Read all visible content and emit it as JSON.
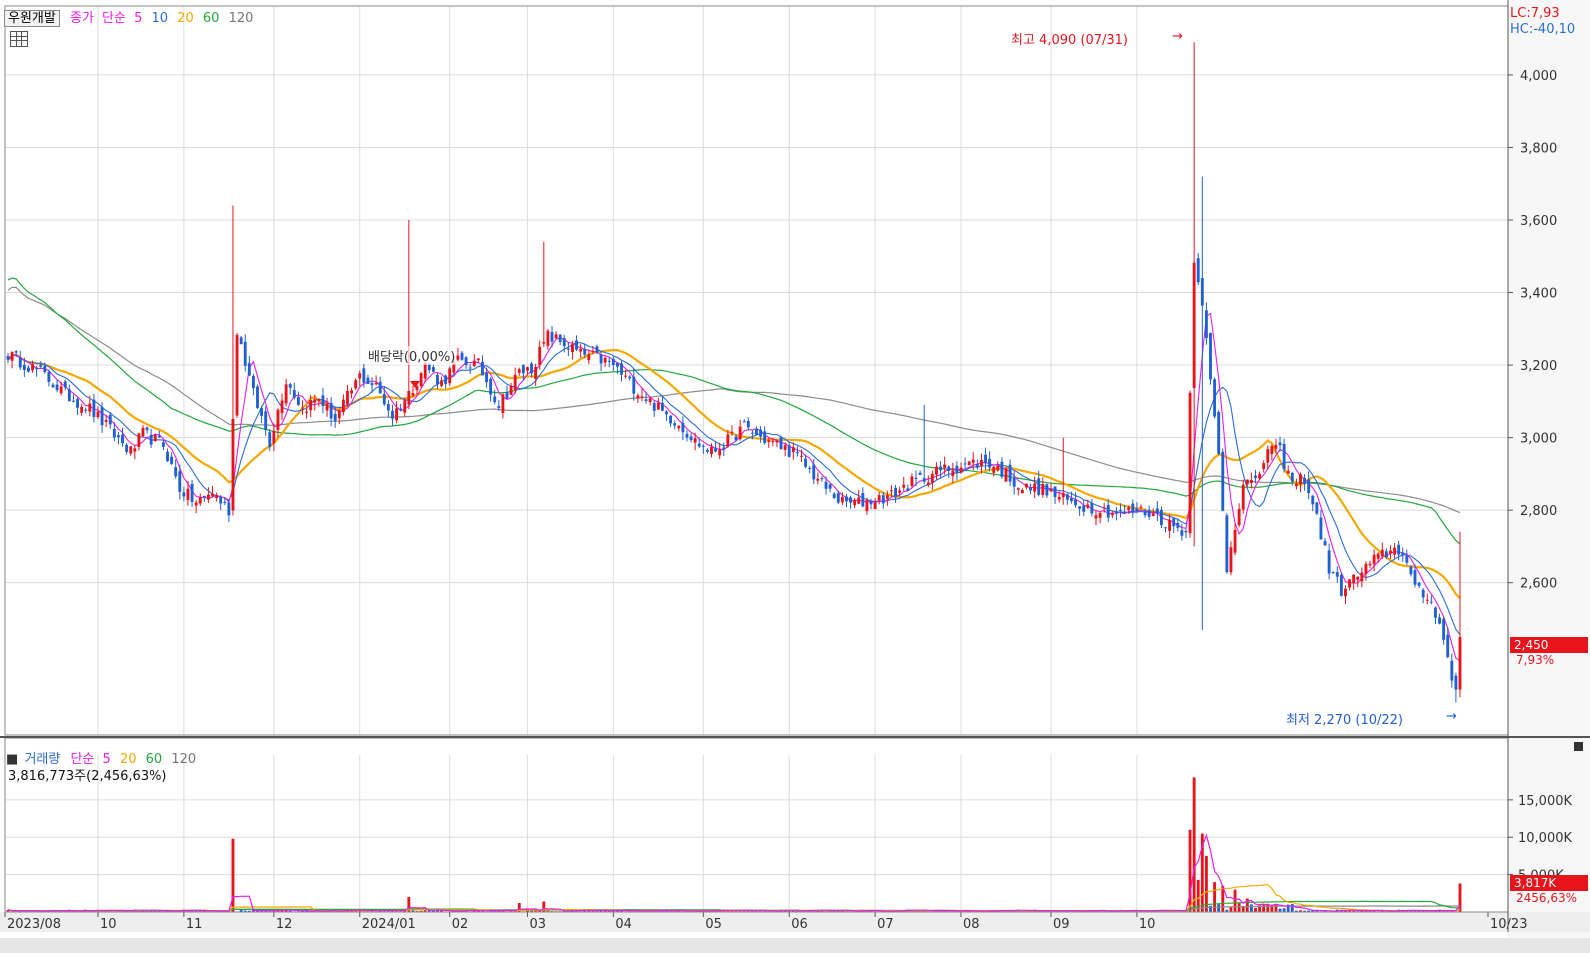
{
  "header": {
    "stock_name": "우원개발",
    "price_label": "종가",
    "ma_label": "단순",
    "ma_periods": [
      "5",
      "10",
      "20",
      "60",
      "120"
    ]
  },
  "volume_header": {
    "label": "거래량",
    "ma_label": "단순",
    "ma_periods": [
      "5",
      "20",
      "60",
      "120"
    ],
    "current": "3,816,773주(2,456,63%)"
  },
  "right_info": {
    "lc": "LC:7,93",
    "hc": "HC:-40,10"
  },
  "price_tag": {
    "value": "2,450",
    "pct": "7,93%"
  },
  "volume_tag": {
    "value": "3,817K",
    "pct": "2456,63%"
  },
  "colors": {
    "up": "#e8141c",
    "down": "#1f5fd6",
    "ma5": "#e81ee8",
    "ma10": "#2a6dd9",
    "ma20": "#f5a800",
    "ma60": "#22a83a",
    "ma120": "#8c8c8c",
    "grid": "#dcdcdc",
    "frame": "#8a8a8a"
  },
  "annotations": {
    "high": "최고 4,090 (07/31)",
    "low": "최저 2,270 (10/22)",
    "dividend": "배당락(0,00%)"
  },
  "chart_data": {
    "type": "candlestick",
    "date_range": [
      "2023/08",
      "10/23"
    ],
    "x_labels": [
      "2023/08",
      "10",
      "11",
      "12",
      "2024/01",
      "02",
      "03",
      "04",
      "05",
      "06",
      "07",
      "08",
      "09",
      "10",
      "10/23"
    ],
    "price_axis": {
      "ylim": [
        2180,
        4190
      ],
      "ticks": [
        2600,
        2800,
        3000,
        3200,
        3400,
        3600,
        3800,
        4000
      ],
      "tick_labels": [
        "2,600",
        "2,800",
        "3,000",
        "3,200",
        "3,400",
        "3,600",
        "3,800",
        "4,000"
      ]
    },
    "volume_axis": {
      "ylim": [
        0,
        21000
      ],
      "ticks": [
        5000,
        10000,
        15000
      ],
      "tick_labels": [
        "5,000K",
        "10,000K",
        "15,000K"
      ]
    },
    "high": {
      "value": 4090,
      "date": "07/31"
    },
    "low": {
      "value": 2270,
      "date": "10/22"
    },
    "last_close": 2450,
    "price_anchors": [
      [
        0,
        3230
      ],
      [
        8,
        3180
      ],
      [
        14,
        3120
      ],
      [
        20,
        3080
      ],
      [
        25,
        3020
      ],
      [
        30,
        2960
      ],
      [
        33,
        3010
      ],
      [
        38,
        2980
      ],
      [
        42,
        2860
      ],
      [
        46,
        2820
      ],
      [
        50,
        2850
      ],
      [
        54,
        2800
      ],
      [
        56,
        3300
      ],
      [
        60,
        3120
      ],
      [
        64,
        2990
      ],
      [
        68,
        3160
      ],
      [
        72,
        3080
      ],
      [
        76,
        3110
      ],
      [
        80,
        3050
      ],
      [
        86,
        3170
      ],
      [
        90,
        3140
      ],
      [
        94,
        3060
      ],
      [
        98,
        3120
      ],
      [
        102,
        3200
      ],
      [
        106,
        3150
      ],
      [
        110,
        3210
      ],
      [
        115,
        3200
      ],
      [
        120,
        3090
      ],
      [
        125,
        3180
      ],
      [
        128,
        3190
      ],
      [
        132,
        3280
      ],
      [
        136,
        3260
      ],
      [
        140,
        3230
      ],
      [
        144,
        3220
      ],
      [
        148,
        3200
      ],
      [
        152,
        3150
      ],
      [
        156,
        3110
      ],
      [
        160,
        3070
      ],
      [
        164,
        3040
      ],
      [
        168,
        2990
      ],
      [
        172,
        2960
      ],
      [
        176,
        2990
      ],
      [
        180,
        3030
      ],
      [
        184,
        3000
      ],
      [
        188,
        2980
      ],
      [
        192,
        2960
      ],
      [
        196,
        2910
      ],
      [
        200,
        2860
      ],
      [
        204,
        2820
      ],
      [
        208,
        2820
      ],
      [
        212,
        2830
      ],
      [
        216,
        2840
      ],
      [
        220,
        2870
      ],
      [
        224,
        2890
      ],
      [
        228,
        2910
      ],
      [
        232,
        2920
      ],
      [
        236,
        2930
      ],
      [
        240,
        2930
      ],
      [
        244,
        2900
      ],
      [
        248,
        2860
      ],
      [
        252,
        2860
      ],
      [
        256,
        2840
      ],
      [
        260,
        2820
      ],
      [
        264,
        2810
      ],
      [
        268,
        2800
      ],
      [
        272,
        2790
      ],
      [
        276,
        2800
      ],
      [
        280,
        2790
      ],
      [
        284,
        2760
      ],
      [
        288,
        2740
      ],
      [
        290,
        3500
      ],
      [
        292,
        3380
      ],
      [
        294,
        3150
      ],
      [
        296,
        2950
      ],
      [
        298,
        2640
      ],
      [
        300,
        2760
      ],
      [
        302,
        2880
      ],
      [
        305,
        2870
      ],
      [
        308,
        2970
      ],
      [
        311,
        2960
      ],
      [
        314,
        2870
      ],
      [
        317,
        2890
      ],
      [
        320,
        2780
      ],
      [
        323,
        2640
      ],
      [
        326,
        2580
      ],
      [
        329,
        2610
      ],
      [
        332,
        2640
      ],
      [
        335,
        2670
      ],
      [
        338,
        2690
      ],
      [
        341,
        2690
      ],
      [
        344,
        2580
      ],
      [
        347,
        2560
      ],
      [
        350,
        2500
      ],
      [
        352,
        2390
      ],
      [
        354,
        2310
      ],
      [
        355,
        2450
      ]
    ],
    "volume_highlights": [
      [
        55,
        9800
      ],
      [
        98,
        2000
      ],
      [
        125,
        1200
      ],
      [
        131,
        1400
      ],
      [
        289,
        11000
      ],
      [
        290,
        18000
      ],
      [
        291,
        4300
      ],
      [
        292,
        10500
      ],
      [
        293,
        7500
      ],
      [
        295,
        4000
      ],
      [
        297,
        3500
      ],
      [
        300,
        3000
      ],
      [
        303,
        1800
      ],
      [
        355,
        3817
      ]
    ]
  }
}
